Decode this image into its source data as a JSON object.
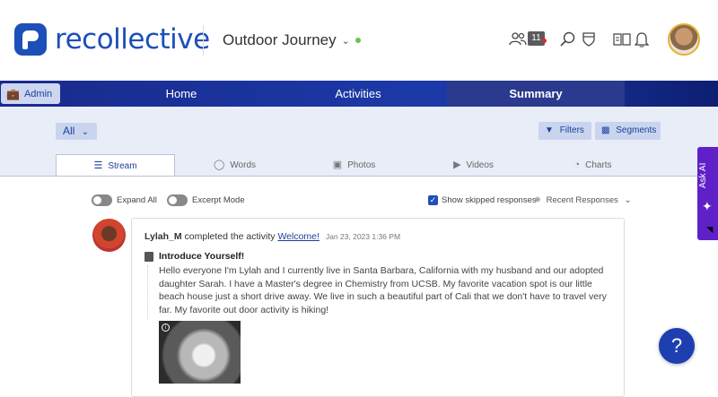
{
  "header": {
    "brand": "recollective",
    "project_name": "Outdoor Journey",
    "notification_count": "11"
  },
  "nav": {
    "admin_label": "Admin",
    "items": [
      {
        "label": "Home"
      },
      {
        "label": "Activities"
      },
      {
        "label": "Summary"
      }
    ]
  },
  "filters": {
    "all_label": "All",
    "filters_label": "Filters",
    "segments_label": "Segments"
  },
  "tabs": [
    {
      "label": "Stream",
      "icon": "list-icon"
    },
    {
      "label": "Words",
      "icon": "chat-icon"
    },
    {
      "label": "Photos",
      "icon": "image-icon"
    },
    {
      "label": "Videos",
      "icon": "video-icon"
    },
    {
      "label": "Charts",
      "icon": "pie-icon"
    }
  ],
  "controls": {
    "expand_all": "Expand All",
    "excerpt_mode": "Excerpt Mode",
    "show_skipped": "Show skipped responses",
    "sort_label": "Recent Responses"
  },
  "post": {
    "author": "Lylah_M",
    "action": "completed the activity",
    "activity_link": "Welcome!",
    "date": "Jan 23, 2023 1:36 PM",
    "question_title": "Introduce Yourself!",
    "body": "Hello everyone I'm Lylah and I currently live in Santa Barbara, California with my husband and our adopted daughter Sarah. I have a Master's degree in Chemistry from UCSB. My favorite vacation spot is our little beach house just a short drive away. We live in such a beautiful part of Cali that we don't have to travel very far. My favorite out door activity is hiking!"
  },
  "ask_ai": {
    "label": "Ask AI"
  },
  "help": {
    "label": "?"
  },
  "colors": {
    "brand": "#1d4fb8",
    "nav": "#1b3aa8",
    "ask_ai": "#6020c8"
  }
}
